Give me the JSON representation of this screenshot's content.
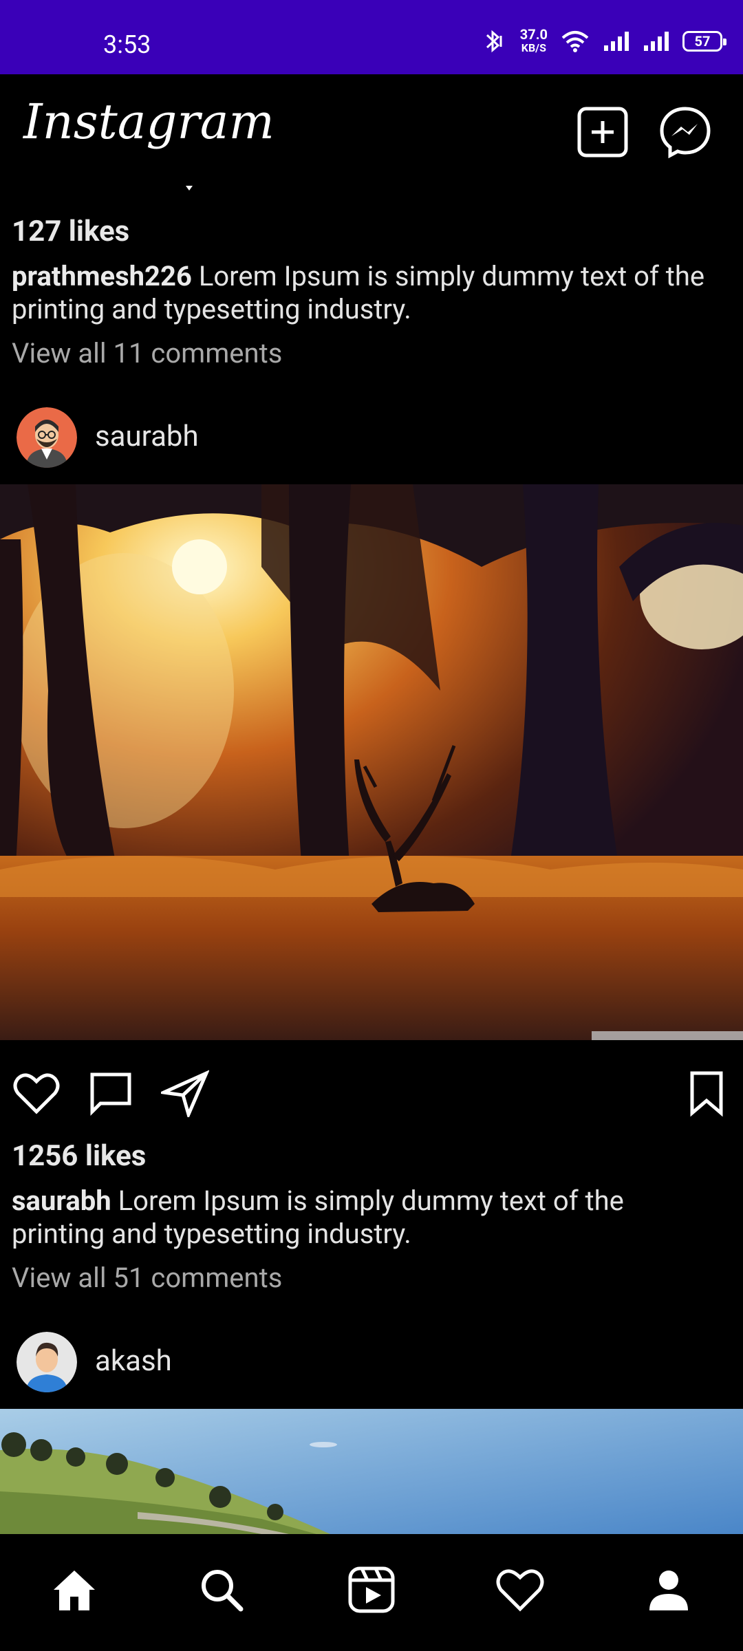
{
  "status_bar": {
    "time": "3:53",
    "net_speed_value": "37.0",
    "net_speed_unit": "KB/S",
    "battery_level": "57"
  },
  "app_bar": {
    "title": "Instagram"
  },
  "posts": [
    {
      "likes": "127 likes",
      "author": "prathmesh226",
      "caption_text": " Lorem Ipsum is simply dummy text of the printing and typesetting industry.",
      "comments": "View all 11 comments"
    },
    {
      "author": "saurabh",
      "likes": "1256 likes",
      "caption_text": " Lorem Ipsum is simply dummy text of the printing and typesetting industry.",
      "comments": "View all 51 comments"
    },
    {
      "author": "akash"
    }
  ],
  "colors": {
    "status_bar": "#3a00b8",
    "background": "#000000",
    "text": "#ffffff",
    "secondary_text": "#a9a9a9"
  }
}
